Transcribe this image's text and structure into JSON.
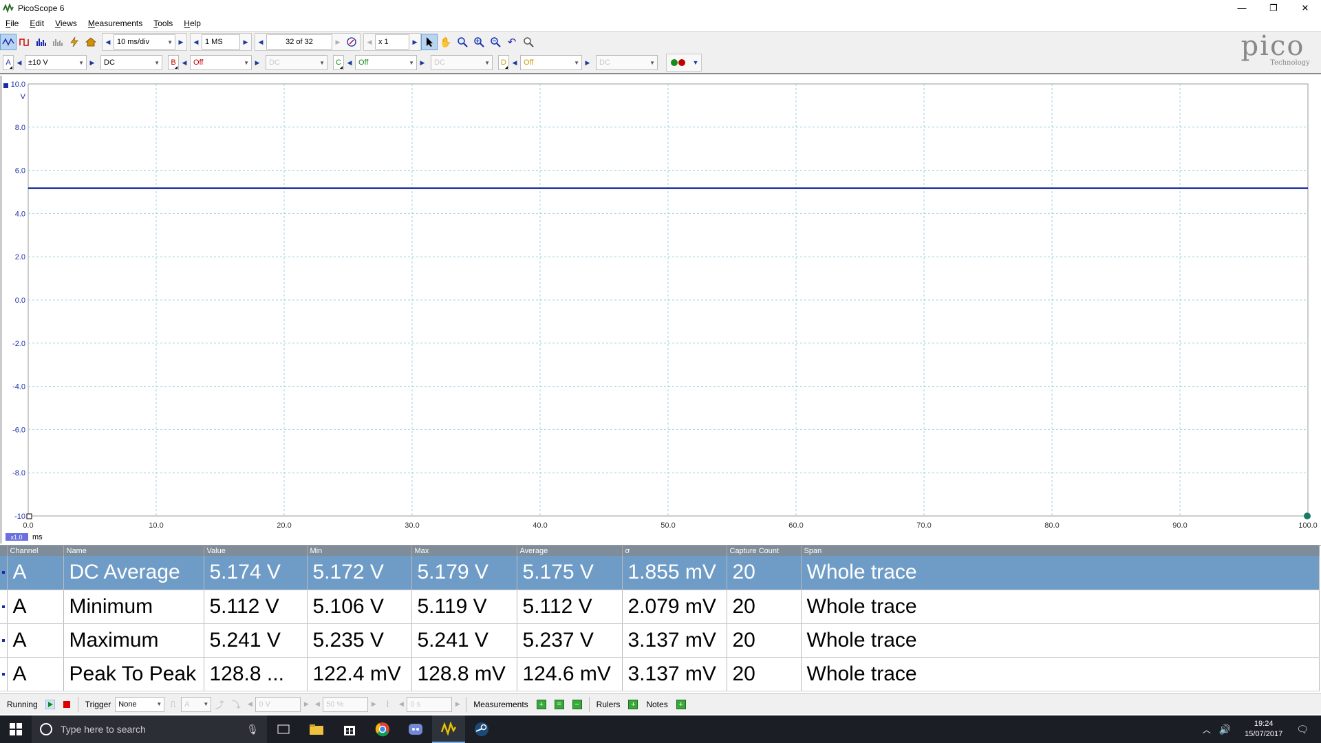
{
  "window": {
    "title": "PicoScope 6",
    "minimize": "—",
    "restore": "❐",
    "close": "✕"
  },
  "menu": [
    "File",
    "Edit",
    "Views",
    "Measurements",
    "Tools",
    "Help"
  ],
  "toolbar1": {
    "timebase": "10 ms/div",
    "samples": "1 MS",
    "buffer": "32 of 32",
    "zoom": "x 1"
  },
  "toolbar2": {
    "channels": [
      {
        "label": "A",
        "range": "±10 V",
        "coupling": "DC",
        "color": "#1a2aa8"
      },
      {
        "label": "B",
        "range": "Off",
        "coupling": "DC",
        "color": "#c00000"
      },
      {
        "label": "C",
        "range": "Off",
        "coupling": "DC",
        "color": "#1a8a1a"
      },
      {
        "label": "D",
        "range": "Off",
        "coupling": "DC",
        "color": "#c8a000"
      }
    ]
  },
  "logo": {
    "word": "pico",
    "sub": "Technology"
  },
  "chart_data": {
    "type": "line",
    "xlabel": "ms",
    "ylabel": "V",
    "xlim": [
      0,
      100
    ],
    "ylim": [
      -10,
      10
    ],
    "x_ticks": [
      "0.0",
      "10.0",
      "20.0",
      "30.0",
      "40.0",
      "50.0",
      "60.0",
      "70.0",
      "80.0",
      "90.0",
      "100.0"
    ],
    "y_ticks": [
      "10.0",
      "8.0",
      "6.0",
      "4.0",
      "2.0",
      "0.0",
      "-2.0",
      "-4.0",
      "-6.0",
      "-8.0",
      "-10"
    ],
    "zoom_badge": "x1.0",
    "grid": true,
    "series": [
      {
        "color": "#1a2aa8",
        "x": [
          0,
          100
        ],
        "values": [
          5.17,
          5.17
        ]
      }
    ]
  },
  "measurements": {
    "headers": [
      "Channel",
      "Name",
      "Value",
      "Min",
      "Max",
      "Average",
      "σ",
      "Capture Count",
      "Span"
    ],
    "rows": [
      [
        "A",
        "DC Average",
        "5.174 V",
        "5.172 V",
        "5.179 V",
        "5.175 V",
        "1.855 mV",
        "20",
        "Whole trace"
      ],
      [
        "A",
        "Minimum",
        "5.112 V",
        "5.106 V",
        "5.119 V",
        "5.112 V",
        "2.079 mV",
        "20",
        "Whole trace"
      ],
      [
        "A",
        "Maximum",
        "5.241 V",
        "5.235 V",
        "5.241 V",
        "5.237 V",
        "3.137 mV",
        "20",
        "Whole trace"
      ],
      [
        "A",
        "Peak To Peak",
        "128.8 ...",
        "122.4 mV",
        "128.8 mV",
        "124.6 mV",
        "3.137 mV",
        "20",
        "Whole trace"
      ]
    ],
    "selected_row": 0
  },
  "statusbar": {
    "running": "Running",
    "trigger_label": "Trigger",
    "trigger_mode": "None",
    "trigger_source": "A",
    "trigger_level": "0 V",
    "pre_trigger": "50 %",
    "delay": "0 s",
    "measurements_label": "Measurements",
    "rulers_label": "Rulers",
    "notes_label": "Notes"
  },
  "taskbar": {
    "search_placeholder": "Type here to search",
    "time": "19:24",
    "date": "15/07/2017"
  }
}
